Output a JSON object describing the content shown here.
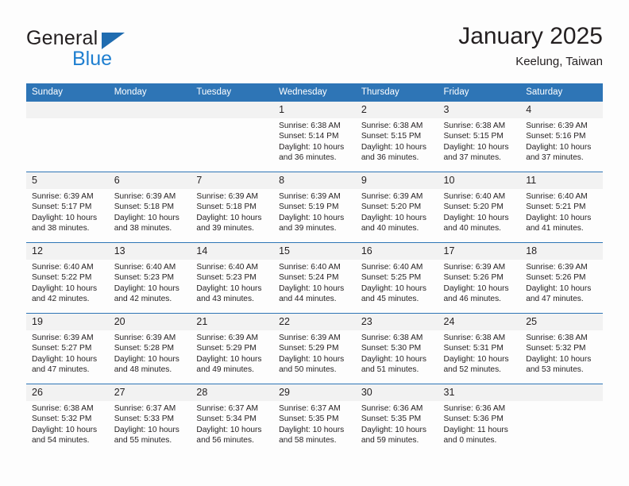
{
  "brand": {
    "word_general": "General",
    "word_blue": "Blue",
    "triangle_color": "#1f6cb0",
    "blue_color": "#1f7fd0"
  },
  "header": {
    "title": "January 2025",
    "subtitle": "Keelung, Taiwan"
  },
  "theme": {
    "header_bg": "#2e75b6",
    "daynum_bg": "#f2f2f2",
    "text": "#231f20",
    "page_bg": "#fdfdfd"
  },
  "weekdays": [
    "Sunday",
    "Monday",
    "Tuesday",
    "Wednesday",
    "Thursday",
    "Friday",
    "Saturday"
  ],
  "weeks": [
    [
      {
        "day": "",
        "blank": true
      },
      {
        "day": "",
        "blank": true
      },
      {
        "day": "",
        "blank": true
      },
      {
        "day": "1",
        "sunrise": "Sunrise: 6:38 AM",
        "sunset": "Sunset: 5:14 PM",
        "daylight1": "Daylight: 10 hours",
        "daylight2": "and 36 minutes."
      },
      {
        "day": "2",
        "sunrise": "Sunrise: 6:38 AM",
        "sunset": "Sunset: 5:15 PM",
        "daylight1": "Daylight: 10 hours",
        "daylight2": "and 36 minutes."
      },
      {
        "day": "3",
        "sunrise": "Sunrise: 6:38 AM",
        "sunset": "Sunset: 5:15 PM",
        "daylight1": "Daylight: 10 hours",
        "daylight2": "and 37 minutes."
      },
      {
        "day": "4",
        "sunrise": "Sunrise: 6:39 AM",
        "sunset": "Sunset: 5:16 PM",
        "daylight1": "Daylight: 10 hours",
        "daylight2": "and 37 minutes."
      }
    ],
    [
      {
        "day": "5",
        "sunrise": "Sunrise: 6:39 AM",
        "sunset": "Sunset: 5:17 PM",
        "daylight1": "Daylight: 10 hours",
        "daylight2": "and 38 minutes."
      },
      {
        "day": "6",
        "sunrise": "Sunrise: 6:39 AM",
        "sunset": "Sunset: 5:18 PM",
        "daylight1": "Daylight: 10 hours",
        "daylight2": "and 38 minutes."
      },
      {
        "day": "7",
        "sunrise": "Sunrise: 6:39 AM",
        "sunset": "Sunset: 5:18 PM",
        "daylight1": "Daylight: 10 hours",
        "daylight2": "and 39 minutes."
      },
      {
        "day": "8",
        "sunrise": "Sunrise: 6:39 AM",
        "sunset": "Sunset: 5:19 PM",
        "daylight1": "Daylight: 10 hours",
        "daylight2": "and 39 minutes."
      },
      {
        "day": "9",
        "sunrise": "Sunrise: 6:39 AM",
        "sunset": "Sunset: 5:20 PM",
        "daylight1": "Daylight: 10 hours",
        "daylight2": "and 40 minutes."
      },
      {
        "day": "10",
        "sunrise": "Sunrise: 6:40 AM",
        "sunset": "Sunset: 5:20 PM",
        "daylight1": "Daylight: 10 hours",
        "daylight2": "and 40 minutes."
      },
      {
        "day": "11",
        "sunrise": "Sunrise: 6:40 AM",
        "sunset": "Sunset: 5:21 PM",
        "daylight1": "Daylight: 10 hours",
        "daylight2": "and 41 minutes."
      }
    ],
    [
      {
        "day": "12",
        "sunrise": "Sunrise: 6:40 AM",
        "sunset": "Sunset: 5:22 PM",
        "daylight1": "Daylight: 10 hours",
        "daylight2": "and 42 minutes."
      },
      {
        "day": "13",
        "sunrise": "Sunrise: 6:40 AM",
        "sunset": "Sunset: 5:23 PM",
        "daylight1": "Daylight: 10 hours",
        "daylight2": "and 42 minutes."
      },
      {
        "day": "14",
        "sunrise": "Sunrise: 6:40 AM",
        "sunset": "Sunset: 5:23 PM",
        "daylight1": "Daylight: 10 hours",
        "daylight2": "and 43 minutes."
      },
      {
        "day": "15",
        "sunrise": "Sunrise: 6:40 AM",
        "sunset": "Sunset: 5:24 PM",
        "daylight1": "Daylight: 10 hours",
        "daylight2": "and 44 minutes."
      },
      {
        "day": "16",
        "sunrise": "Sunrise: 6:40 AM",
        "sunset": "Sunset: 5:25 PM",
        "daylight1": "Daylight: 10 hours",
        "daylight2": "and 45 minutes."
      },
      {
        "day": "17",
        "sunrise": "Sunrise: 6:39 AM",
        "sunset": "Sunset: 5:26 PM",
        "daylight1": "Daylight: 10 hours",
        "daylight2": "and 46 minutes."
      },
      {
        "day": "18",
        "sunrise": "Sunrise: 6:39 AM",
        "sunset": "Sunset: 5:26 PM",
        "daylight1": "Daylight: 10 hours",
        "daylight2": "and 47 minutes."
      }
    ],
    [
      {
        "day": "19",
        "sunrise": "Sunrise: 6:39 AM",
        "sunset": "Sunset: 5:27 PM",
        "daylight1": "Daylight: 10 hours",
        "daylight2": "and 47 minutes."
      },
      {
        "day": "20",
        "sunrise": "Sunrise: 6:39 AM",
        "sunset": "Sunset: 5:28 PM",
        "daylight1": "Daylight: 10 hours",
        "daylight2": "and 48 minutes."
      },
      {
        "day": "21",
        "sunrise": "Sunrise: 6:39 AM",
        "sunset": "Sunset: 5:29 PM",
        "daylight1": "Daylight: 10 hours",
        "daylight2": "and 49 minutes."
      },
      {
        "day": "22",
        "sunrise": "Sunrise: 6:39 AM",
        "sunset": "Sunset: 5:29 PM",
        "daylight1": "Daylight: 10 hours",
        "daylight2": "and 50 minutes."
      },
      {
        "day": "23",
        "sunrise": "Sunrise: 6:38 AM",
        "sunset": "Sunset: 5:30 PM",
        "daylight1": "Daylight: 10 hours",
        "daylight2": "and 51 minutes."
      },
      {
        "day": "24",
        "sunrise": "Sunrise: 6:38 AM",
        "sunset": "Sunset: 5:31 PM",
        "daylight1": "Daylight: 10 hours",
        "daylight2": "and 52 minutes."
      },
      {
        "day": "25",
        "sunrise": "Sunrise: 6:38 AM",
        "sunset": "Sunset: 5:32 PM",
        "daylight1": "Daylight: 10 hours",
        "daylight2": "and 53 minutes."
      }
    ],
    [
      {
        "day": "26",
        "sunrise": "Sunrise: 6:38 AM",
        "sunset": "Sunset: 5:32 PM",
        "daylight1": "Daylight: 10 hours",
        "daylight2": "and 54 minutes."
      },
      {
        "day": "27",
        "sunrise": "Sunrise: 6:37 AM",
        "sunset": "Sunset: 5:33 PM",
        "daylight1": "Daylight: 10 hours",
        "daylight2": "and 55 minutes."
      },
      {
        "day": "28",
        "sunrise": "Sunrise: 6:37 AM",
        "sunset": "Sunset: 5:34 PM",
        "daylight1": "Daylight: 10 hours",
        "daylight2": "and 56 minutes."
      },
      {
        "day": "29",
        "sunrise": "Sunrise: 6:37 AM",
        "sunset": "Sunset: 5:35 PM",
        "daylight1": "Daylight: 10 hours",
        "daylight2": "and 58 minutes."
      },
      {
        "day": "30",
        "sunrise": "Sunrise: 6:36 AM",
        "sunset": "Sunset: 5:35 PM",
        "daylight1": "Daylight: 10 hours",
        "daylight2": "and 59 minutes."
      },
      {
        "day": "31",
        "sunrise": "Sunrise: 6:36 AM",
        "sunset": "Sunset: 5:36 PM",
        "daylight1": "Daylight: 11 hours",
        "daylight2": "and 0 minutes."
      },
      {
        "day": "",
        "blank": true
      }
    ]
  ]
}
